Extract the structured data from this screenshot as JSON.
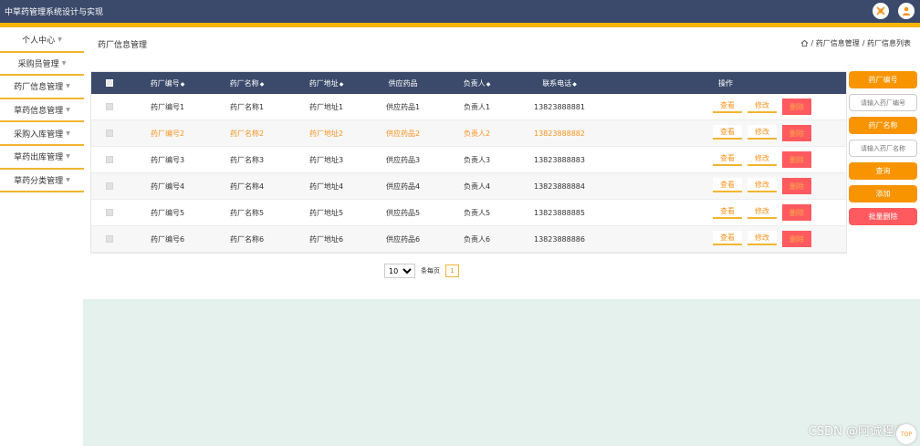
{
  "app": {
    "title": "中草药管理系统设计与实现"
  },
  "sidebar": {
    "items": [
      {
        "label": "个人中心"
      },
      {
        "label": "采购员管理"
      },
      {
        "label": "药厂信息管理"
      },
      {
        "label": "草药信息管理"
      },
      {
        "label": "采购入库管理"
      },
      {
        "label": "草药出库管理"
      },
      {
        "label": "草药分类管理"
      }
    ]
  },
  "page": {
    "title": "药厂信息管理",
    "breadcrumb": [
      "/ 药厂信息管理",
      "/ 药厂信息列表"
    ]
  },
  "table": {
    "columns": [
      "药厂编号",
      "药厂名称",
      "药厂地址",
      "供应药品",
      "负责人",
      "联系电话",
      "操作"
    ],
    "rows": [
      {
        "code": "药厂编号1",
        "name": "药厂名称1",
        "address": "药厂地址1",
        "drug": "供应药品1",
        "owner": "负责人1",
        "phone": "13823888881"
      },
      {
        "code": "药厂编号2",
        "name": "药厂名称2",
        "address": "药厂地址2",
        "drug": "供应药品2",
        "owner": "负责人2",
        "phone": "13823888882"
      },
      {
        "code": "药厂编号3",
        "name": "药厂名称3",
        "address": "药厂地址3",
        "drug": "供应药品3",
        "owner": "负责人3",
        "phone": "13823888883"
      },
      {
        "code": "药厂编号4",
        "name": "药厂名称4",
        "address": "药厂地址4",
        "drug": "供应药品4",
        "owner": "负责人4",
        "phone": "13823888884"
      },
      {
        "code": "药厂编号5",
        "name": "药厂名称5",
        "address": "药厂地址5",
        "drug": "供应药品5",
        "owner": "负责人5",
        "phone": "13823888885"
      },
      {
        "code": "药厂编号6",
        "name": "药厂名称6",
        "address": "药厂地址6",
        "drug": "供应药品6",
        "owner": "负责人6",
        "phone": "13823888886"
      }
    ],
    "actions": {
      "view": "查看",
      "edit": "修改",
      "delete": "删除"
    }
  },
  "pagination": {
    "page_size": "10",
    "per_page_label": "条每页",
    "current_page": "1"
  },
  "search": {
    "code_label": "药厂编号",
    "code_placeholder": "请输入药厂编号",
    "name_label": "药厂名称",
    "name_placeholder": "请输入药厂名称",
    "query_label": "查询",
    "add_label": "添加",
    "batch_delete_label": "批量删除"
  },
  "watermark": "CSDN @阿诚程序",
  "back_to_top": "TOP",
  "colors": {
    "header": "#3b4a6b",
    "accent": "#f7931e",
    "accent_bar": "#f7b500",
    "danger": "#ff5a5f",
    "mint": "#e5f1ed"
  }
}
